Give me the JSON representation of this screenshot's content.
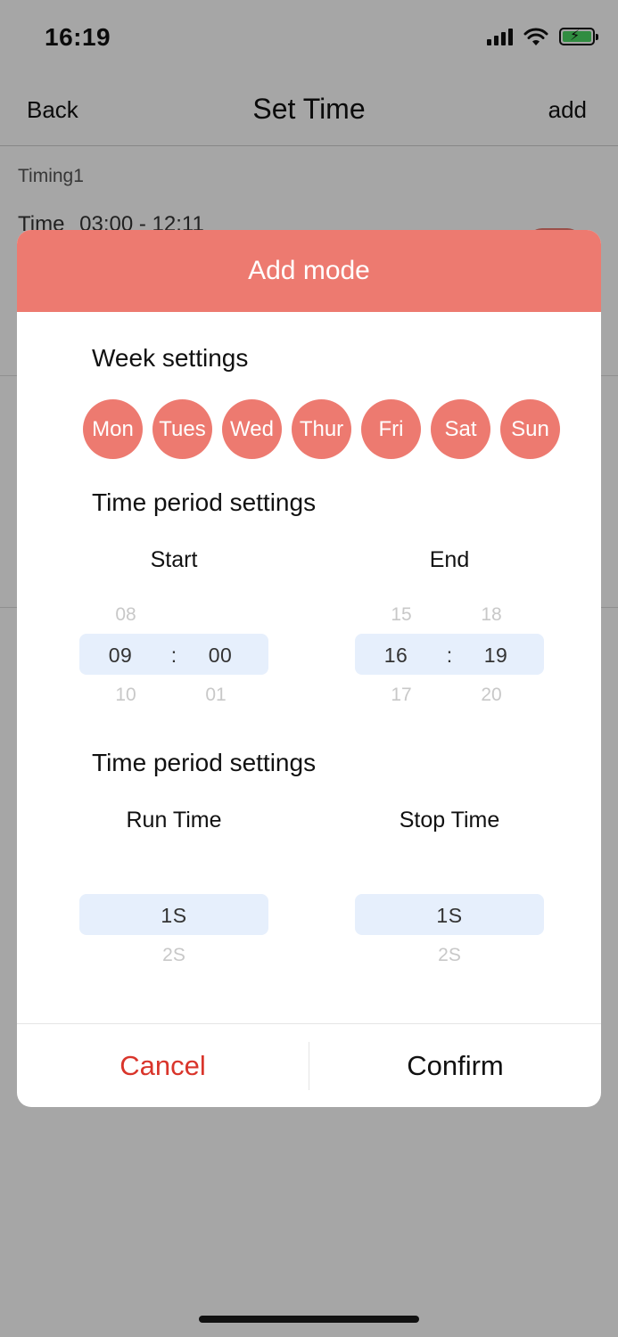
{
  "status_bar": {
    "time": "16:19"
  },
  "nav": {
    "back_label": "Back",
    "title": "Set Time",
    "add_label": "add"
  },
  "timing_list": [
    {
      "name": "Timing1",
      "time_label": "Time",
      "time_range": "03:00 - 12:11"
    }
  ],
  "modal": {
    "title": "Add mode",
    "week_settings_title": "Week settings",
    "days": [
      "Mon",
      "Tues",
      "Wed",
      "Thur",
      "Fri",
      "Sat",
      "Sun"
    ],
    "time_period_title": "Time period settings",
    "start": {
      "label": "Start",
      "hour": {
        "prev": "08",
        "selected": "09",
        "next": "10"
      },
      "minute": {
        "prev": "",
        "selected": "00",
        "next": "01"
      }
    },
    "end": {
      "label": "End",
      "hour": {
        "prev": "15",
        "selected": "16",
        "next": "17"
      },
      "minute": {
        "prev": "18",
        "selected": "19",
        "next": "20"
      }
    },
    "separator": ":",
    "run_stop_title": "Time period settings",
    "run_time": {
      "label": "Run Time",
      "selected": "1S",
      "next": "2S"
    },
    "stop_time": {
      "label": "Stop Time",
      "selected": "1S",
      "next": "2S"
    },
    "cancel_label": "Cancel",
    "confirm_label": "Confirm"
  },
  "colors": {
    "accent": "#ed7a70",
    "cancel": "#d9352b",
    "picker_highlight": "#e6effc"
  },
  "icons": [
    "signal-icon",
    "wifi-icon",
    "battery-charging-icon"
  ]
}
